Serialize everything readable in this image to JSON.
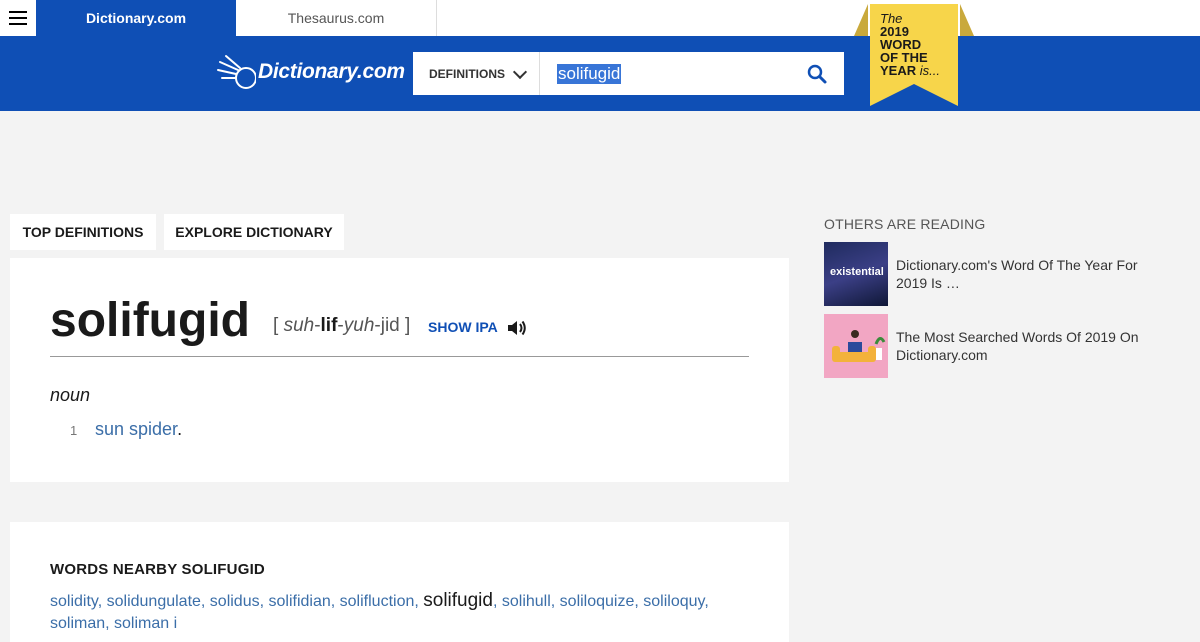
{
  "topbar": {
    "tabs": [
      "Dictionary.com",
      "Thesaurus.com"
    ]
  },
  "header": {
    "logo_text": "Dictionary.com",
    "search": {
      "type_label": "DEFINITIONS",
      "query": "solifugid"
    },
    "woty": {
      "line1": "The",
      "line2": "2019",
      "line3": "WORD",
      "line4": "OF THE",
      "line5": "YEAR",
      "line5b": "is..."
    }
  },
  "nav": {
    "top_definitions": "TOP DEFINITIONS",
    "explore": "EXPLORE DICTIONARY"
  },
  "entry": {
    "headword": "solifugid",
    "pron_open": "[ ",
    "pron_s1": "suh",
    "pron_s2": "lif",
    "pron_s3": "yuh",
    "pron_s4": "jid",
    "pron_close": " ]",
    "show_ipa": "SHOW IPA",
    "part_of_speech": "noun",
    "definitions": [
      {
        "number": "1",
        "link": "sun spider",
        "tail": "."
      }
    ]
  },
  "nearby": {
    "title": "WORDS NEARBY SOLIFUGID",
    "words": [
      "solidity",
      "solidungulate",
      "solidus",
      "solifidian",
      "solifluction",
      "solifugid",
      "solihull",
      "soliloquize",
      "soliloquy",
      "soliman",
      "soliman i"
    ],
    "current": "solifugid"
  },
  "sidebar": {
    "title": "OTHERS ARE READING",
    "items": [
      {
        "thumb_text": "existential",
        "title": "Dictionary.com's Word Of The Year For 2019 Is …"
      },
      {
        "title": "The Most Searched Words Of 2019 On Dictionary.com"
      }
    ]
  },
  "colors": {
    "brand_blue": "#0f4fb5",
    "link_blue": "#3b6ea8",
    "woty_yellow": "#f7d54a"
  }
}
